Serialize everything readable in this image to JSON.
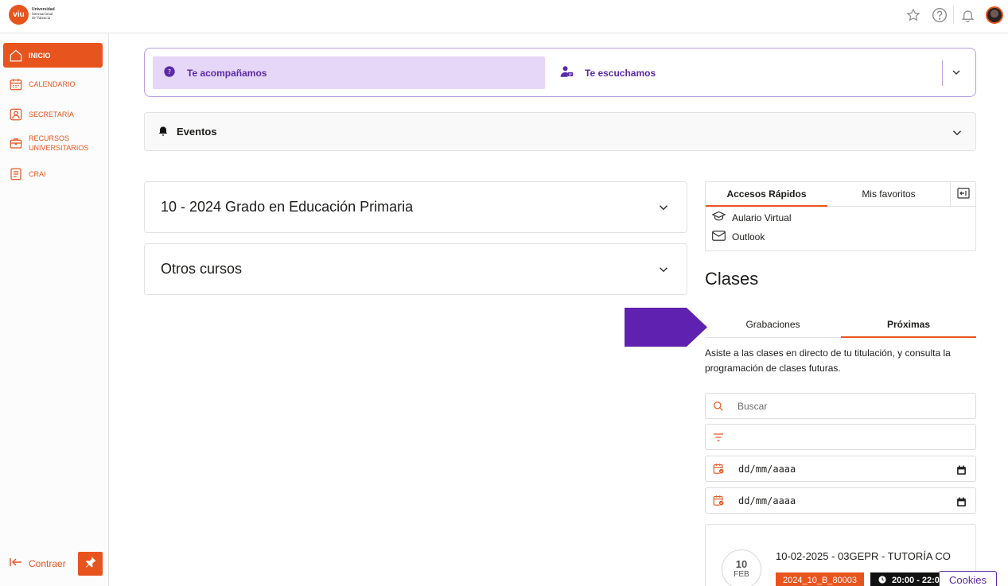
{
  "header": {
    "logo": {
      "mark": "viu",
      "name_line1": "Universidad",
      "name_line2": "Internacional",
      "name_line3": "de Valencia"
    },
    "icons": [
      "star-icon",
      "help-icon",
      "bell-icon",
      "avatar"
    ]
  },
  "sidebar": {
    "items": [
      {
        "label": "INICIO",
        "icon": "home-icon",
        "active": true
      },
      {
        "label": "CALENDARIO",
        "icon": "calendar-icon",
        "active": false
      },
      {
        "label": "SECRETARÍA",
        "icon": "user-card-icon",
        "active": false
      },
      {
        "label": "RECURSOS UNIVERSITARIOS",
        "icon": "briefcase-icon",
        "active": false
      },
      {
        "label": "CRAI",
        "icon": "document-icon",
        "active": false
      }
    ],
    "collapse_label": "Contraer"
  },
  "support": {
    "accompany_label": "Te acompañamos",
    "listen_label": "Te escuchamos"
  },
  "events": {
    "label": "Eventos"
  },
  "courses": [
    {
      "title": "10 - 2024 Grado en Educación Primaria"
    },
    {
      "title": "Otros cursos"
    }
  ],
  "quick_access": {
    "tabs": [
      "Accesos Rápidos",
      "Mis favoritos"
    ],
    "links": [
      {
        "label": "Aulario Virtual",
        "icon": "graduation-cap-icon"
      },
      {
        "label": "Outlook",
        "icon": "mail-icon"
      }
    ]
  },
  "classes": {
    "title": "Clases",
    "tabs": [
      "Grabaciones",
      "Próximas"
    ],
    "active_tab": "Próximas",
    "description": "Asiste a las clases en directo de tu titulación, y consulta la programación de clases futuras.",
    "search_placeholder": "Buscar",
    "date_placeholder_1": "dd/mm/aaaa",
    "date_placeholder_2": "dd/mm/aaaa",
    "items": [
      {
        "day": "10",
        "month": "FEB",
        "title": "10-02-2025 - 03GEPR - TUTORÍA CO",
        "code": "2024_10_B_80003",
        "time": "20:00 - 22:00"
      }
    ]
  },
  "cookies_label": "Cookies",
  "colors": {
    "accent": "#e8541e",
    "purple": "#5b2aa8",
    "lavender": "#e6d6f8"
  }
}
